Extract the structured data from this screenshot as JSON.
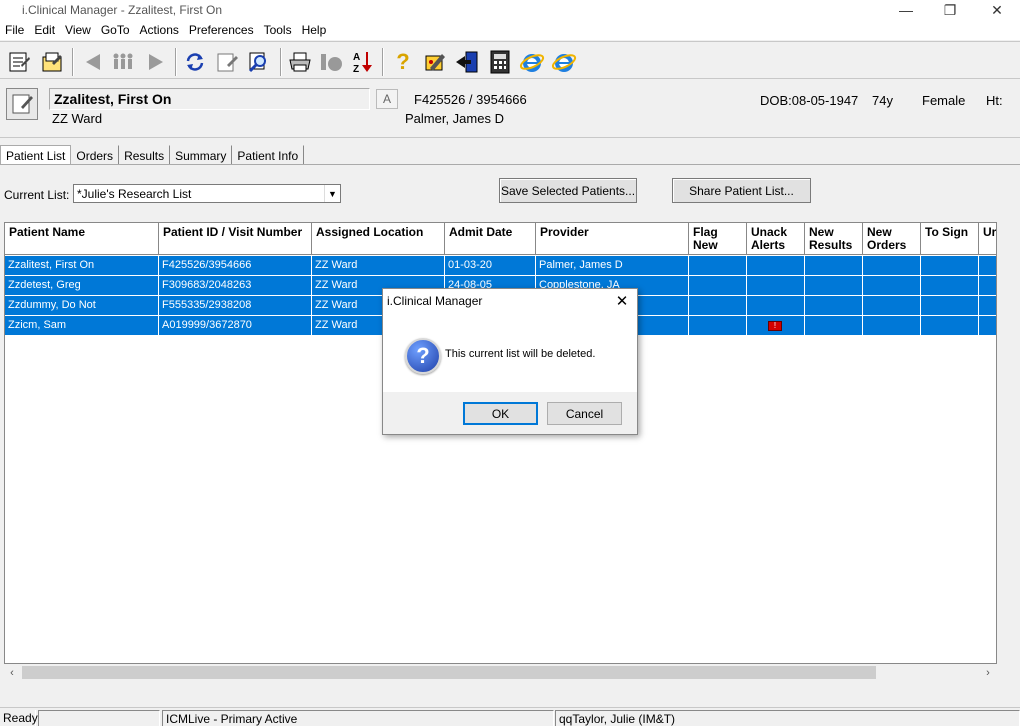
{
  "window": {
    "title": "i.Clinical Manager - Zzalitest, First On",
    "minimize_glyph": "—",
    "restore_glyph": "❐",
    "close_glyph": "✕"
  },
  "menu": [
    "File",
    "Edit",
    "View",
    "GoTo",
    "Actions",
    "Preferences",
    "Tools",
    "Help"
  ],
  "toolbar": {
    "icons": [
      "patient-list-icon",
      "edit-list-icon",
      "back-arrow-icon",
      "people-icon",
      "forward-arrow-icon",
      "refresh-icon",
      "edit-note-icon",
      "binoculars-icon",
      "printer-icon",
      "sort-icon",
      "az-sort-icon",
      "help-icon",
      "tools-icon",
      "exit-icon",
      "calculator-icon",
      "internet-explorer-icon",
      "internet-explorer-icon-2"
    ],
    "help_glyph": "?",
    "az_glyph": "A↓Z"
  },
  "patient": {
    "name": "Zzalitest, First On",
    "ward": "ZZ Ward",
    "a_label": "A",
    "id_visit": "F425526 / 3954666",
    "provider": "Palmer, James D",
    "dob": "DOB:08-05-1947",
    "age": "74y",
    "sex": "Female",
    "ht": "Ht:"
  },
  "tabs": [
    "Patient List",
    "Orders",
    "Results",
    "Summary",
    "Patient Info"
  ],
  "current_list": {
    "label": "Current List:",
    "value": "*Julie's Research List"
  },
  "buttons": {
    "save_selected": "Save Selected Patients...",
    "share_list": "Share Patient List..."
  },
  "grid": {
    "columns": [
      {
        "label": "Patient Name"
      },
      {
        "label": "Patient ID / Visit Number"
      },
      {
        "label": "Assigned Location"
      },
      {
        "label": "Admit Date"
      },
      {
        "label": "Provider"
      },
      {
        "label": "Flag New"
      },
      {
        "label": "Unack Alerts"
      },
      {
        "label": "New Results"
      },
      {
        "label": "New Orders"
      },
      {
        "label": "To Sign"
      },
      {
        "label": "Ur"
      }
    ],
    "rows": [
      {
        "name": "Zzalitest, First On",
        "id": "F425526/3954666",
        "location": "ZZ Ward",
        "admit": "01-03-20",
        "provider": "Palmer, James D",
        "alert": false
      },
      {
        "name": "Zzdetest, Greg",
        "id": "F309683/2048263",
        "location": "ZZ Ward",
        "admit": "24-08-05",
        "provider": "Copplestone, JA",
        "alert": false
      },
      {
        "name": "Zzdummy, Do Not",
        "id": "F555335/2938208",
        "location": "ZZ Ward",
        "admit": "",
        "provider": "",
        "alert": false
      },
      {
        "name": "Zzicm, Sam",
        "id": "A019999/3672870",
        "location": "ZZ Ward",
        "admit": "",
        "provider": "",
        "alert": true
      }
    ]
  },
  "status": {
    "ready": "Ready",
    "system": "ICMLive - Primary Active",
    "user": "qqTaylor, Julie (IM&T)"
  },
  "dialog": {
    "title": "i.Clinical Manager",
    "message": "This current list will be deleted.",
    "ok": "OK",
    "cancel": "Cancel",
    "icon_glyph": "?"
  }
}
